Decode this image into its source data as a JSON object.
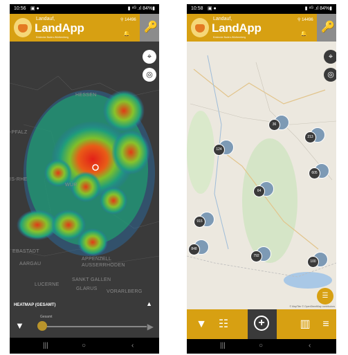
{
  "status_left": {
    "time": "10:56",
    "icons": "▣ ●",
    "right": "▮ ⁶ᴳ .ıl 84%▮"
  },
  "status_right": {
    "time": "10:58",
    "icons": "▣ ●",
    "right": "▮ ⁶ᴳ .ıl 84%▮"
  },
  "app": {
    "title_small": "Landauf,",
    "title_big": "LandApp",
    "title_sub": "Entdecke Baden-Württemberg",
    "location_count": "14496",
    "pin_icon": "⚲",
    "bell_icon": "🔔",
    "key_icon": "🔑"
  },
  "map_left": {
    "binoculars_icon": "⌖",
    "locate_icon": "◎",
    "labels": {
      "hessen": "HESSEN",
      "pfalz": "-PFALZ",
      "rhein": "IS-RHE",
      "wurt": "WÜR",
      "aargau": "AARGAU",
      "appenzell": "APPENZELL AUSSERRHODEN",
      "sanktgallen": "SANKT GALLEN",
      "lucerne": "LUCERNE",
      "glarus": "GLARUS",
      "vorarlberg": "VORARLBERG",
      "ebastadt": "EBASTADT"
    }
  },
  "heatmap_panel": {
    "title": "HEATMAP (GESAMT)",
    "caret_icon": "▲",
    "filter_icon": "▼",
    "slider_label": "Gesamt",
    "play_icon": "▶"
  },
  "clusters": [
    {
      "count": "36"
    },
    {
      "count": "124"
    },
    {
      "count": "213"
    },
    {
      "count": "605"
    },
    {
      "count": "64"
    },
    {
      "count": "915"
    },
    {
      "count": "848"
    },
    {
      "count": "792"
    },
    {
      "count": "100"
    }
  ],
  "map_right": {
    "binoculars_icon": "⌖",
    "locate_icon": "◎",
    "attribution": "© MapTiler © OpenStreetMap contributors",
    "fab_icon": "☰"
  },
  "bottom_bar": {
    "filter_icon": "▼",
    "list_icon": "☷",
    "add_icon": "+",
    "chart_icon": "▥",
    "menu_icon": "≡"
  },
  "navbar": {
    "recent": "|||",
    "home": "○",
    "back": "‹"
  }
}
